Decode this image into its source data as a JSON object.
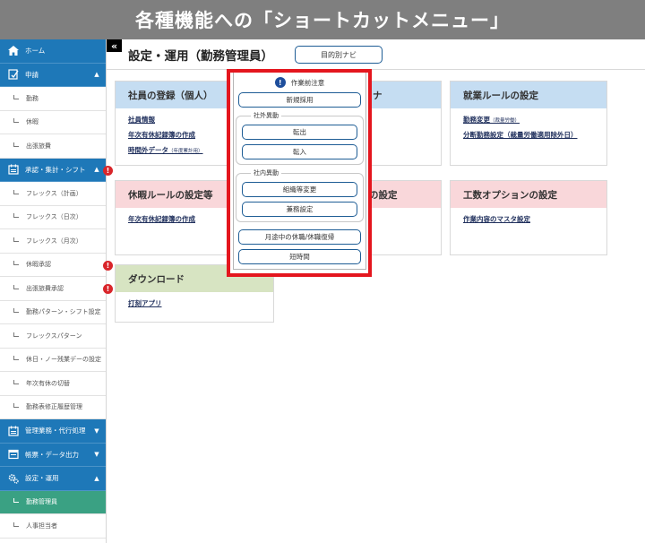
{
  "banner": {
    "title": "各種機能への「ショートカットメニュー」"
  },
  "sidebar": {
    "items": [
      {
        "kind": "head",
        "label": "ホーム",
        "icon": "home-icon",
        "chevron": ""
      },
      {
        "kind": "head",
        "label": "申請",
        "icon": "form-icon",
        "chevron": "^"
      },
      {
        "kind": "sub",
        "label": "勤務"
      },
      {
        "kind": "sub",
        "label": "休暇"
      },
      {
        "kind": "sub",
        "label": "出張旅費"
      },
      {
        "kind": "head",
        "label": "承認・集計・シフト",
        "icon": "calendar-icon",
        "chevron": "^",
        "alert": "!"
      },
      {
        "kind": "sub",
        "label": "フレックス（計画）"
      },
      {
        "kind": "sub",
        "label": "フレックス（日次）"
      },
      {
        "kind": "sub",
        "label": "フレックス（月次）"
      },
      {
        "kind": "sub",
        "label": "休暇承認",
        "alert": "!"
      },
      {
        "kind": "sub",
        "label": "出張旅費承認",
        "alert": "!"
      },
      {
        "kind": "sub",
        "label": "勤務パターン・シフト設定"
      },
      {
        "kind": "sub",
        "label": "フレックスパターン"
      },
      {
        "kind": "sub",
        "label": "休日・ノー残業デーの設定"
      },
      {
        "kind": "sub",
        "label": "年次有休の切替"
      },
      {
        "kind": "sub",
        "label": "勤務表修正履歴管理"
      },
      {
        "kind": "head",
        "label": "管理業務・代行処理",
        "icon": "calendar-icon",
        "chevron": "v"
      },
      {
        "kind": "head",
        "label": "帳票・データ出力",
        "icon": "window-icon",
        "chevron": "v"
      },
      {
        "kind": "head",
        "label": "設定・運用",
        "icon": "gear-icon",
        "chevron": "^"
      },
      {
        "kind": "sub",
        "label": "勤務管理員",
        "active": true
      },
      {
        "kind": "sub",
        "label": "人事担当者"
      }
    ]
  },
  "collapse_label": "«",
  "page": {
    "title": "設定・運用（勤務管理員）",
    "nav_button": "目的別ナビ"
  },
  "cards": {
    "employee": {
      "title": "社員の登録（個人）",
      "links": [
        {
          "text": "社員情報",
          "note": ""
        },
        {
          "text": "年次有休記録簿の作成",
          "note": ""
        },
        {
          "text": "時間外データ",
          "note": "（年度累計用）"
        }
      ]
    },
    "hidden_top": {
      "title": "ナ"
    },
    "work_rules": {
      "title": "就業ルールの設定",
      "links": [
        {
          "text": "勤務変更",
          "note": "（裁量労働）"
        },
        {
          "text": "分断勤務設定（裁量労働適用除外日）",
          "note": ""
        }
      ]
    },
    "leave_rules": {
      "title": "休暇ルールの設定等",
      "links": [
        {
          "text": "年次有休記録簿の作成",
          "note": ""
        }
      ]
    },
    "hidden_mid": {
      "title": "の設定"
    },
    "workload": {
      "title": "工数オプションの設定",
      "links": [
        {
          "text": "作業内容のマスタ設定",
          "note": ""
        }
      ]
    },
    "download": {
      "title": "ダウンロード",
      "links": [
        {
          "text": "打刻アプリ",
          "note": ""
        }
      ]
    }
  },
  "popup": {
    "notice": "作業前注意",
    "new_hire": "新規採用",
    "external_group": {
      "label": "社外異動",
      "buttons": [
        "転出",
        "転入"
      ]
    },
    "internal_group": {
      "label": "社内異動",
      "buttons": [
        "組織等変更",
        "兼務設定"
      ]
    },
    "leave_return": "月途中の休職/休職復帰",
    "short_hours": "短時間"
  },
  "colors": {
    "banner": "#7f7f7f",
    "sidebar_head": "#1e78b8",
    "sidebar_active": "#3aa183",
    "alert": "#d9252a",
    "highlight_frame": "#e4161e"
  }
}
